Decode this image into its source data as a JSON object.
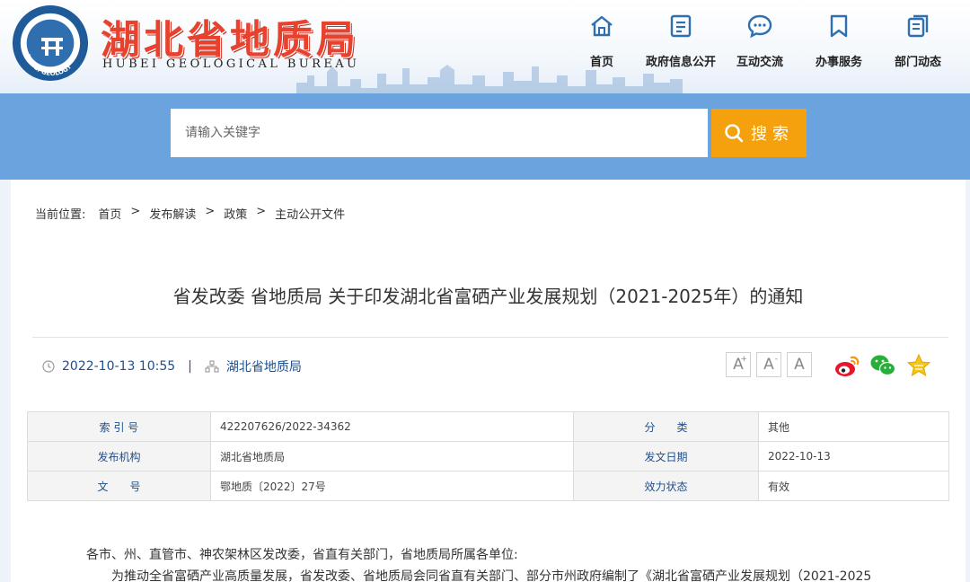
{
  "header": {
    "brand_cn": "湖北省地质局",
    "brand_en": "HUBEI GEOLOGICAL BUREAU",
    "logo_text": "HUBEI GEOLOGY",
    "nav": [
      {
        "label": "首页",
        "icon": "home-icon"
      },
      {
        "label": "政府信息公开",
        "icon": "document-list-icon"
      },
      {
        "label": "互动交流",
        "icon": "chat-bubble-icon"
      },
      {
        "label": "办事服务",
        "icon": "bookmark-icon"
      },
      {
        "label": "部门动态",
        "icon": "pages-icon"
      }
    ],
    "accent_color": "#e8422f",
    "nav_icon_color": "#2f6fb0"
  },
  "search": {
    "placeholder": "请输入关键字",
    "button_label": "搜索",
    "band_color": "#6aa3de",
    "button_color": "#f5a10e"
  },
  "breadcrumb": {
    "lead": "当前位置:",
    "items": [
      "首页",
      "发布解读",
      "政策",
      "主动公开文件"
    ],
    "separator": ">"
  },
  "article": {
    "title": "省发改委 省地质局 关于印发湖北省富硒产业发展规划（2021-2025年）的通知",
    "date": "2022-10-13 10:55",
    "source": "湖北省地质局",
    "font_sizes": [
      "A+",
      "A-",
      "A"
    ],
    "share": [
      "weibo-icon",
      "wechat-icon",
      "favorite-star-icon"
    ]
  },
  "info_table": {
    "rows": [
      {
        "k1": "索 引 号",
        "v1": "422207626/2022-34362",
        "k2": "分　　类",
        "v2": "其他"
      },
      {
        "k1": "发布机构",
        "v1": "湖北省地质局",
        "k2": "发文日期",
        "v2": "2022-10-13"
      },
      {
        "k1": "文　　号",
        "v1": "鄂地质〔2022〕27号",
        "k2": "效力状态",
        "v2": "有效"
      }
    ]
  },
  "body": {
    "salutation": "各市、州、直管市、神农架林区发改委，省直有关部门，省地质局所属各单位:",
    "first_line": "为推动全省富硒产业高质量发展，省发改委、省地质局会同省直有关部门、部分市州政府编制了《湖北省富硒产业发展规划（2021-2025"
  }
}
